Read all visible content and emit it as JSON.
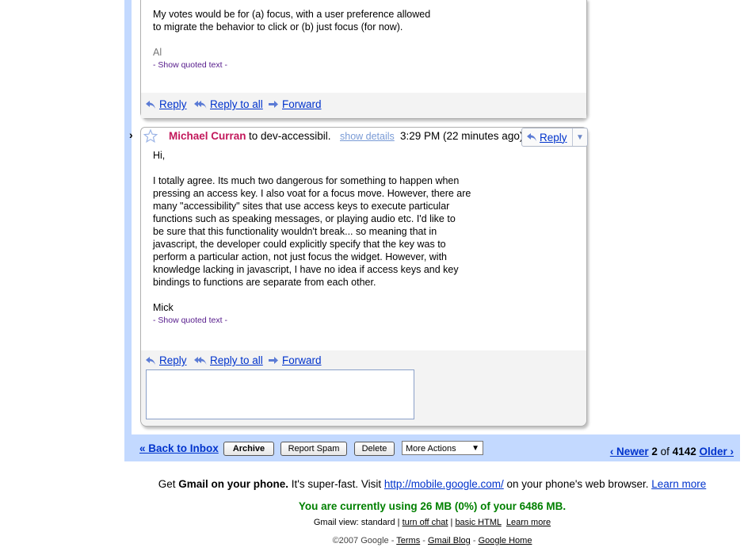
{
  "msg1": {
    "body_lines": [
      "My votes would be for (a) focus, with a user preference allowed",
      "to migrate the behavior to click or (b) just focus (for now)."
    ],
    "signature": "Al",
    "quoted_text": "- Show quoted text -"
  },
  "msg2": {
    "sender": "Michael Curran",
    "to": "to dev-accessibil.",
    "show_details": "show details",
    "time": "3:29 PM (22 minutes ago)",
    "reply_label": "Reply",
    "greeting": "Hi,",
    "body_lines": [
      "I totally agree. Its much two dangerous for something to happen when",
      "pressing an access key. I also voat for a focus move. However, there are",
      "many \"accessibility\" sites that use access keys to execute particular",
      "functions such as speaking messages, or playing audio etc. I'd like to",
      "be sure that this functionality wouldn't break... so meaning that in",
      "javascript, the developer could explicitly specify that the key was to",
      "perform a particular action, not just focus the widget. However, with",
      "knowledge lacking in javascript, I have no idea if access keys and key",
      "bindings to functions are separate from each other."
    ],
    "signature": "Mick",
    "quoted_text": "- Show quoted text -"
  },
  "actions": {
    "reply": "Reply",
    "reply_all": "Reply to all",
    "forward": "Forward"
  },
  "bottombar": {
    "back": "« Back to Inbox",
    "archive": "Archive",
    "report_spam": "Report Spam",
    "delete": "Delete",
    "more_actions": "More Actions",
    "newer": "‹ Newer",
    "current": "2",
    "of": "of",
    "total": "4142",
    "older": "Older ›"
  },
  "footer": {
    "get": "Get",
    "gmail_phone": "Gmail on your phone.",
    "super_fast": " It's super-fast. Visit ",
    "mobile_url": "http://mobile.google.com/",
    "browser": " on your phone's web browser. ",
    "learn_more": "Learn more",
    "usage": "You are currently using 26 MB (0%) of your 6486 MB.",
    "view_label": "Gmail view: standard |",
    "turn_off_chat": "turn off chat",
    "basic_html": "basic HTML",
    "learn_more2": "Learn more",
    "copyright": "©2007 Google -",
    "terms": "Terms",
    "blog": "Gmail Blog",
    "home": "Google Home"
  },
  "colors": {
    "frame_blue": "#c3d9ff",
    "sender_pink": "#c2185b",
    "link_blue": "#0033cc",
    "usage_green": "#008000"
  }
}
